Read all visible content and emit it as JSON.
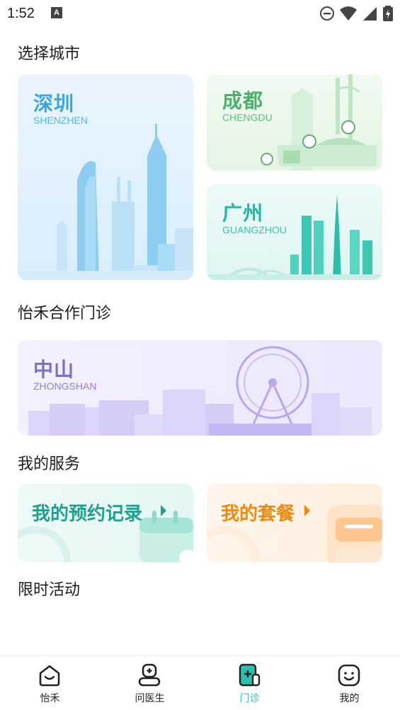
{
  "status_bar": {
    "time": "1:52",
    "notification_badge": "A"
  },
  "sections": {
    "select_city": "选择城市",
    "partner_clinics": "怡禾合作门诊",
    "my_services": "我的服务",
    "events": "限时活动"
  },
  "cities": [
    {
      "name": "深圳",
      "pinyin": "SHENZHEN"
    },
    {
      "name": "成都",
      "pinyin": "CHENGDU"
    },
    {
      "name": "广州",
      "pinyin": "GUANGZHOU"
    }
  ],
  "clinics": [
    {
      "name": "中山",
      "pinyin": "ZHONGSHAN"
    }
  ],
  "services": [
    {
      "label": "我的预约记录"
    },
    {
      "label": "我的套餐"
    }
  ],
  "tabs": [
    {
      "label": "怡禾",
      "icon": "home-face-icon",
      "active": false
    },
    {
      "label": "问医生",
      "icon": "doctor-icon",
      "active": false
    },
    {
      "label": "门诊",
      "icon": "clinic-icon",
      "active": true
    },
    {
      "label": "我的",
      "icon": "profile-face-icon",
      "active": false
    }
  ],
  "colors": {
    "accent": "#2bbfb0",
    "shenzhen_text": "#3ba6dd",
    "chengdu_text": "#4caf6e",
    "guangzhou_text": "#1fb8a3",
    "zhongshan_text": "#7d6fc4",
    "appointments_text": "#1f9f8c",
    "package_text": "#f0890f"
  }
}
